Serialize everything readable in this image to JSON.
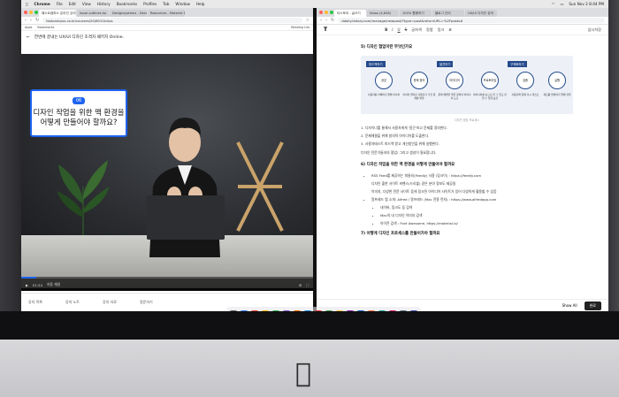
{
  "menubar": {
    "app": "Chrome",
    "items": [
      "File",
      "Edit",
      "View",
      "History",
      "Bookmarks",
      "Profiles",
      "Tab",
      "Window",
      "Help"
    ],
    "clock": "Sun Nov 2  8:44 PM"
  },
  "left_window": {
    "tabs": [
      "패스트캠퍼스 온라인 강의",
      "issue outlines ko",
      "Designsystems - Design",
      "Resources - Material Design"
    ],
    "url": "fastcampus.co.kr/courses/20/6010/clips",
    "bookmarks": [
      "Apps",
      "Bookmarks",
      "Reading List"
    ],
    "course_title": "한번에 끝내는 UX/UI 디자인 초격차 패키지 Online.",
    "overlay_badge": "06",
    "overlay_line1": "디자인 작업을 위한 맥 환경을",
    "overlay_line2": "어떻게 만들어야 할까요?",
    "progress": 0.05,
    "controls": [
      "01:24",
      "자동 재생"
    ],
    "lesson_tabs": [
      "강의 목록",
      "강의 노트",
      "강의 자료",
      "질문하기"
    ]
  },
  "right_window": {
    "tabs": [
      "티스토리 - 글쓰기",
      "Inbox (4,828)",
      "100% 활용하기",
      "블로그 관리",
      "UX/UI 디자인 강의"
    ],
    "url": "ddaily.tistory.com/manage/newpost/?type=post&returnURL=%2Fposts#",
    "toolbar": [
      "B",
      "I",
      "U",
      "S",
      "글자색",
      "정렬",
      "링크",
      "표"
    ],
    "logo": "T",
    "save_button": "임시저장",
    "section5_title": "5) 디자인 협업이란 무엇인가요",
    "diagram": {
      "stages": [
        "피드백하기",
        "발견하기",
        "구체화하기"
      ],
      "steps": [
        "공감",
        "문제 정의",
        "아이디어",
        "프로토타입",
        "검증",
        "실행"
      ],
      "captions": [
        "사용자를 이해하기 위해 리서치",
        "리서치 결과로 사용자가 가진 문제를 발굴",
        "문제 해결을 위한 창의적 아이디어 도출",
        "아이디어를 눈으로 볼 수 있고 만질 수 있게 표현",
        "사용자와 함께 다시 테스트",
        "제조품 발생하기 위해 실행"
      ],
      "footnote": "디자인 씽킹 프로세스"
    },
    "paragraph_lines": [
      "1. 디자이너를 통해서 사용자에게 '알곤'하고 문제를 정의한다.",
      "2. 문제해결을 위해 창의적 아이디어를 도출한다.",
      "3. 사용자테스트 피드백 받고 개선방안을 위해 실행한다."
    ],
    "paragraph_after": "디자인 전문가들과의 협업! 그리고 생성이 필요합니다.",
    "section6_title": "6) 디자인 작업을 위한 맥 환경을 어떻게 만들어야 할까요",
    "bullets": [
      "RSS Feed를 제공하는 피들리(Feedly) 사용 (링크이) : https://feedly.com",
      "디자인 출판 사이트 비핸스(드리블) 같은 분야 정보도 제공됨",
      "이미지, 다양한 전문 사이트 등에 링크된 아이디어 사이트가 있어 다양하게 활용할 수 있음",
      "알프레드 앱 소개: Alfred / 알프레드 (Mac 전용 런처) : https://www.alfredapp.com",
      "네이버, 링크도 등 검색",
      "Mac의 내 디자인 이미지 검색",
      "아이콘 검색 : Font Awesome, https://material.io/"
    ],
    "section7_title": "7) 어떻게 디자인 프로세스를 만들어가야 할까요",
    "publish_button": "완료",
    "show_all": "Show All"
  },
  "dock": {
    "colors": [
      "#5a5a5e",
      "#3478f6",
      "#e94235",
      "#f4b400",
      "#2db14f",
      "#7e57c2",
      "#ff6f00",
      "#1e88e5",
      "#e53935",
      "#43a047",
      "#fbc02d",
      "#8e24aa",
      "#1565c0",
      "#ff7043",
      "#26a69a",
      "#d81b60",
      "#546e7a",
      "#3949ab"
    ]
  }
}
